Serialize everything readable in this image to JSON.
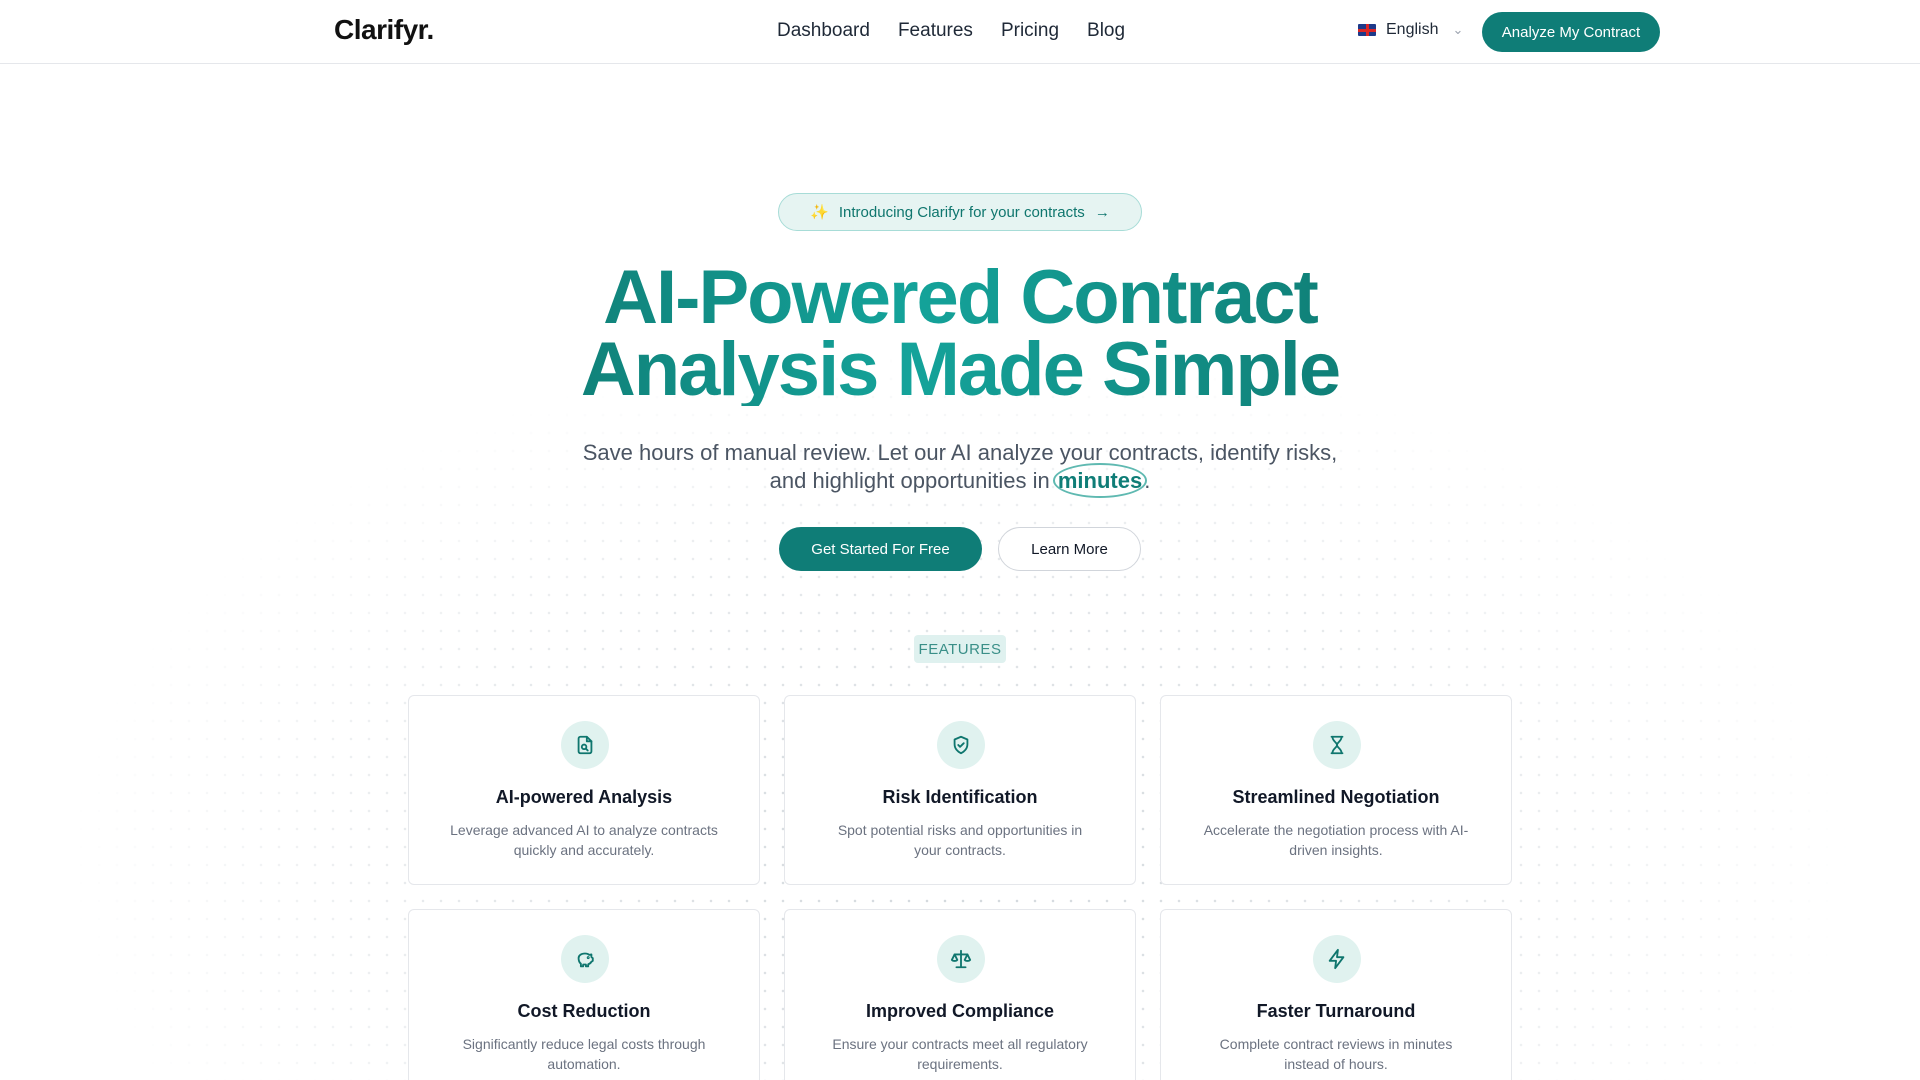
{
  "brand": {
    "logo": "Clarifyr.",
    "accent": "#0f7d77"
  },
  "nav": {
    "links": [
      "Dashboard",
      "Features",
      "Pricing",
      "Blog"
    ],
    "language": "English",
    "cta": "Analyze My Contract"
  },
  "hero": {
    "pill": "Introducing Clarifyr for your contracts",
    "title_line1": "AI-Powered Contract",
    "title_line2": "Analysis Made Simple",
    "subtitle_line1": "Save hours of manual review. Let our AI analyze your contracts, identify risks,",
    "subtitle_line2_prefix": "and highlight opportunities in",
    "subtitle_highlight": "minutes",
    "subtitle_line2_suffix": ".",
    "primary_button": "Get Started For Free",
    "secondary_button": "Learn More"
  },
  "features": {
    "tag": "FEATURES",
    "items": [
      {
        "icon": "document-search-icon",
        "title": "AI-powered Analysis",
        "description": "Leverage advanced AI to analyze contracts quickly and accurately."
      },
      {
        "icon": "shield-check-icon",
        "title": "Risk Identification",
        "description": "Spot potential risks and opportunities in your contracts."
      },
      {
        "icon": "hourglass-icon",
        "title": "Streamlined Negotiation",
        "description": "Accelerate the negotiation process with AI-driven insights."
      },
      {
        "icon": "piggy-bank-icon",
        "title": "Cost Reduction",
        "description": "Significantly reduce legal costs through automation."
      },
      {
        "icon": "scale-icon",
        "title": "Improved Compliance",
        "description": "Ensure your contracts meet all regulatory requirements."
      },
      {
        "icon": "lightning-icon",
        "title": "Faster Turnaround",
        "description": "Complete contract reviews in minutes instead of hours."
      }
    ]
  }
}
